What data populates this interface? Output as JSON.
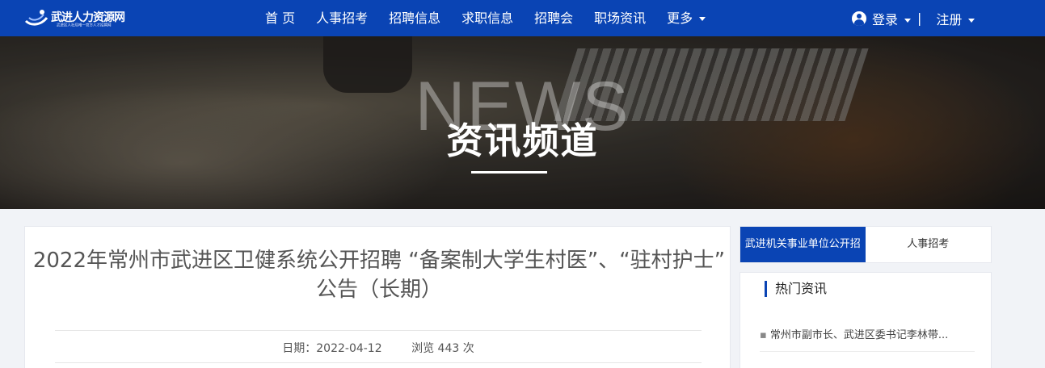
{
  "header": {
    "logo_title": "武进人力资源网",
    "logo_subtitle": "武进区人社局唯一官方人才招聘网",
    "nav": [
      "首 页",
      "人事招考",
      "招聘信息",
      "求职信息",
      "招聘会",
      "职场资讯",
      "更多"
    ],
    "login_label": "登录",
    "divider": "|",
    "register_label": "注册"
  },
  "banner": {
    "bg_word": "NEWS",
    "title": "资讯频道"
  },
  "article": {
    "title": "2022年常州市武进区卫健系统公开招聘 “备案制大学生村医”、“驻村护士” 公告（长期）",
    "date_label": "日期：2022-04-12",
    "views_label": "浏览 443 次"
  },
  "sidebar": {
    "tabs": [
      "武进机关事业单位公开招",
      "人事招考"
    ],
    "hot_title": "热门资讯",
    "hot_items": [
      "常州市副市长、武进区委书记李林带..."
    ]
  },
  "colors": {
    "primary": "#0a44b4",
    "page_bg": "#f1f3f7"
  }
}
